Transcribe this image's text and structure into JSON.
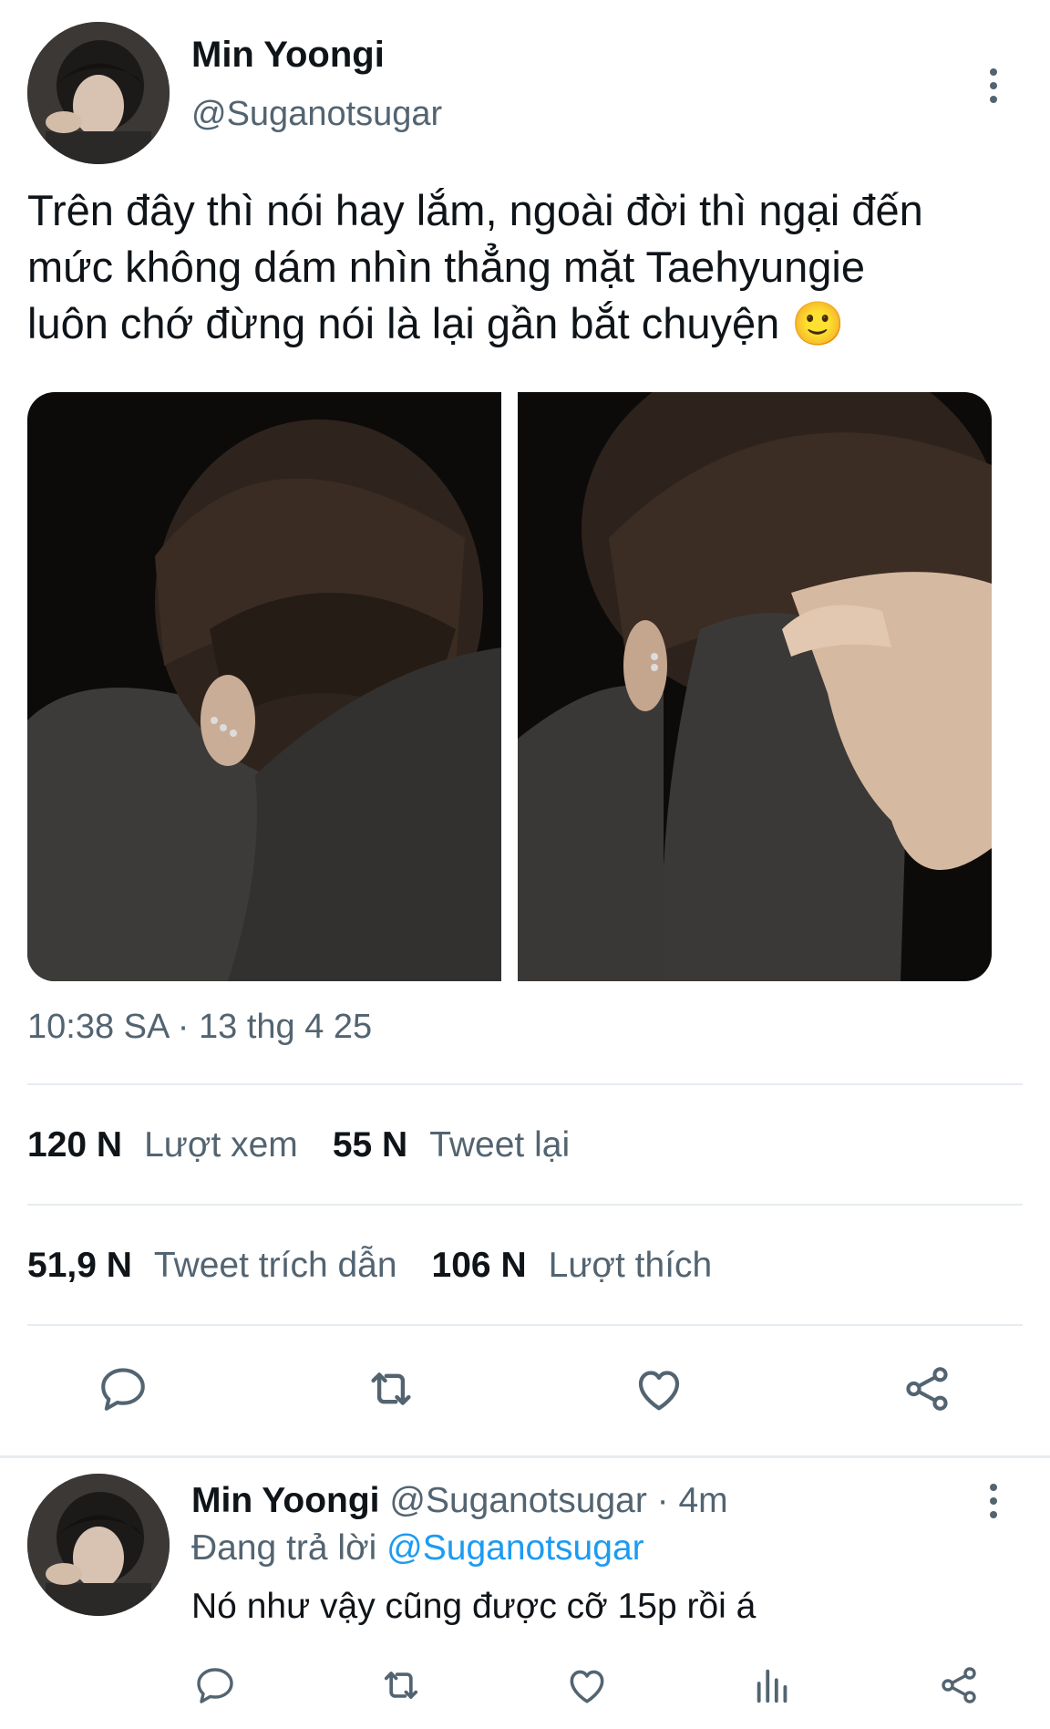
{
  "tweet": {
    "author_name": "Min Yoongi",
    "author_handle": "@Suganotsugar",
    "text": "Trên đây thì nói hay lắm, ngoài đời thì ngại đến\nmức không dám nhìn thẳng mặt Taehyungie\nluôn chớ đừng nói là lại gần bắt chuyện 🙂",
    "timestamp": "10:38 SA · 13 thg 4 25",
    "stats": {
      "views_count": "120 N",
      "views_label": "Lượt xem",
      "retweets_count": "55 N",
      "retweets_label": "Tweet lại",
      "quotes_count": "51,9 N",
      "quotes_label": "Tweet trích dẫn",
      "likes_count": "106 N",
      "likes_label": "Lượt thích"
    },
    "actions": [
      "reply-icon",
      "retweet-icon",
      "like-icon",
      "share-icon"
    ]
  },
  "reply": {
    "author_name": "Min Yoongi",
    "author_handle": "@Suganotsugar",
    "time": "· 4m",
    "replying_prefix": "Đang trả lời",
    "replying_to": "@Suganotsugar",
    "text": "Nó như vậy cũng được cỡ 15p rồi á",
    "actions": [
      "reply-icon",
      "retweet-icon",
      "like-icon",
      "analytics-icon",
      "share-icon"
    ]
  },
  "colors": {
    "text_primary": "#0f1419",
    "text_secondary": "#536471",
    "link": "#1d9bf0",
    "divider": "#e6ecf0"
  }
}
